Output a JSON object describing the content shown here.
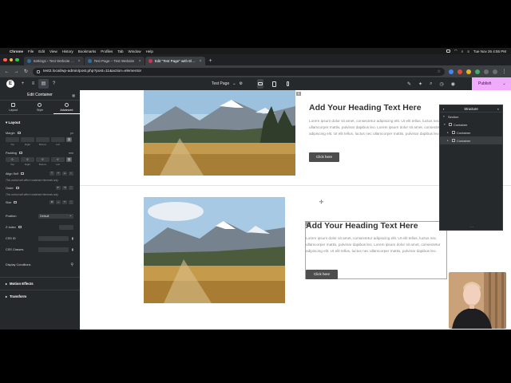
{
  "menubar": {
    "app": "Chrome",
    "items": [
      "File",
      "Edit",
      "View",
      "History",
      "Bookmarks",
      "Profiles",
      "Tab",
      "Window",
      "Help"
    ],
    "datetime": "Tue Nov 26  4:55 PM"
  },
  "tabs": [
    {
      "label": "Settings ‹ Test Website — W…"
    },
    {
      "label": "Test Page – Test Website"
    },
    {
      "label": "Edit \"Test Page\" with Elemen…"
    }
  ],
  "omnibox": {
    "url": "test2.local/wp-admin/post.php?post=11&action=elementor"
  },
  "elementor_bar": {
    "page_name": "Test Page",
    "publish_label": "Publish"
  },
  "panel": {
    "title": "Edit Container",
    "tabs": [
      "Layout",
      "Style",
      "Advanced"
    ],
    "layout_section": "Layout",
    "margin_label": "Margin",
    "margin_unit": "px",
    "margin_box_labels": [
      "Top",
      "Right",
      "Bottom",
      "Left"
    ],
    "padding_label": "Padding",
    "padding_unit": "rem",
    "padding_values": [
      "0",
      "0",
      "0",
      "0"
    ],
    "padding_box_labels": [
      "Top",
      "Right",
      "Bottom",
      "Left"
    ],
    "align_self_label": "Align Self",
    "align_note": "This control will affect contained elements only.",
    "order_label": "Order",
    "order_note": "This control will affect contained elements only.",
    "size_label": "Size",
    "position_label": "Position",
    "position_value": "Default",
    "zindex_label": "Z-Index",
    "cssid_label": "CSS ID",
    "cssclasses_label": "CSS Classes",
    "display_conditions_label": "Display Conditions",
    "motion_effects_label": "Motion Effects",
    "transform_label": "Transform"
  },
  "canvas": {
    "block1": {
      "heading": "Add Your Heading Text Here",
      "paragraph": "Lorem ipsum dolor sit amet, consectetur adipiscing elit. Ut elit tellus, luctus nec ullamcorper mattis, pulvinar dapibus leo. Lorem ipsum dolor sit amet, consectetur adipiscing elit. Ut elit tellus, luctus nec ullamcorper mattis, pulvinar dapibus leo.",
      "button": "Click here"
    },
    "block2": {
      "heading": "Add Your Heading Text Here",
      "paragraph": "Lorem ipsum dolor sit amet, consectetur adipiscing elit. Ut elit tellus, luctus nec ullamcorper mattis, pulvinar dapibus leo. Lorem ipsum dolor sit amet, consectetur adipiscing elit. Ut elit tellus, luctus nec ullamcorper mattis, pulvinar dapibus leo.",
      "button": "Click here"
    }
  },
  "structure": {
    "title": "Structure",
    "items": [
      "Section",
      "Container",
      "Container",
      "Container"
    ]
  },
  "colors": {
    "publish": "#f0abfc",
    "panel_bg": "#26292c",
    "canvas_bg": "#ffffff",
    "button_bg": "#4d4d4d"
  }
}
